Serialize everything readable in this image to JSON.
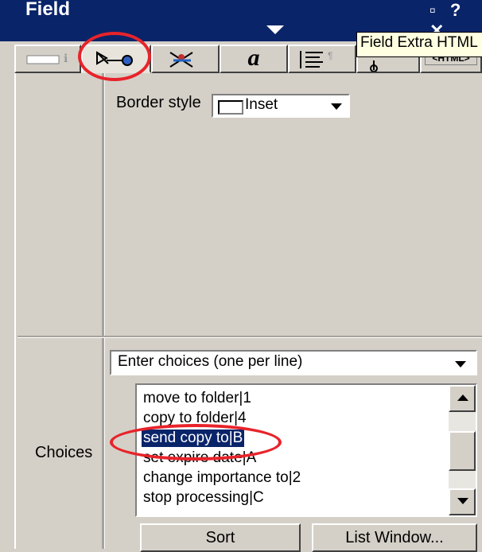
{
  "window": {
    "title": "Field",
    "buttons": "▫ ? ✕"
  },
  "tooltip": "Field Extra HTML",
  "tabs": [
    {
      "name": "basics",
      "icon": "field-basics-icon"
    },
    {
      "name": "advanced",
      "icon": "field-advanced-icon",
      "selected": true
    },
    {
      "name": "control",
      "icon": "control-icon"
    },
    {
      "name": "font",
      "icon": "font-icon",
      "glyph": "a"
    },
    {
      "name": "paragraph",
      "icon": "paragraph-icon"
    },
    {
      "name": "hide",
      "icon": "hide-when-icon"
    },
    {
      "name": "html",
      "icon": "html-icon",
      "glyph": "<HTML>"
    }
  ],
  "border": {
    "label": "Border style",
    "value": "Inset"
  },
  "choices": {
    "label": "Choices",
    "source": "Enter choices (one per line)",
    "items": [
      "move to folder|1",
      "copy to folder|4",
      "send copy to|B",
      "set expire date|A",
      "change importance to|2",
      "stop processing|C"
    ],
    "selected_index": 2,
    "sort_label": "Sort",
    "list_window_label": "List Window..."
  }
}
